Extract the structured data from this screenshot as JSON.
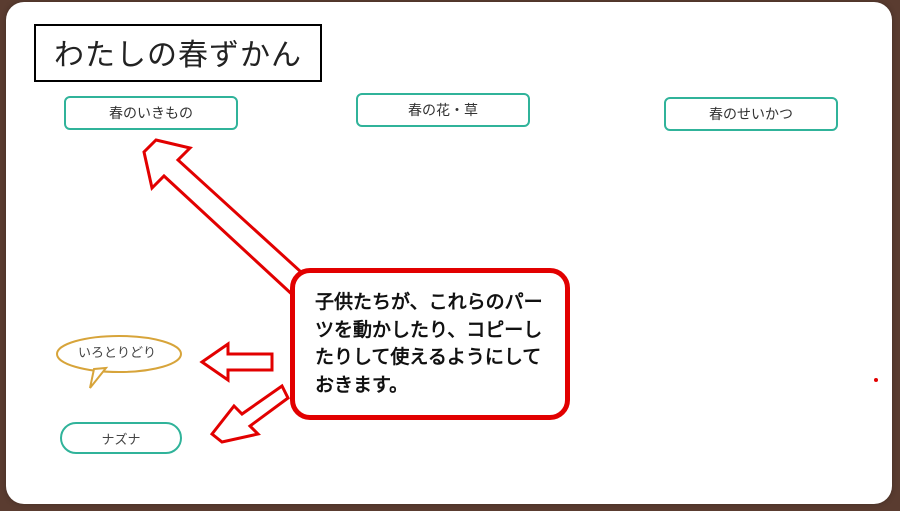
{
  "title": "わたしの春ずかん",
  "cards": {
    "ikimono": "春のいきもの",
    "hanakusa": "春の花・草",
    "seikatsu": "春のせいかつ"
  },
  "bubble_text": "いろとりどり",
  "small_label": "ナズナ",
  "callout_text": "子供たちが、これらのパーツを動かしたり、コピーしたりして使えるようにしておきます。"
}
